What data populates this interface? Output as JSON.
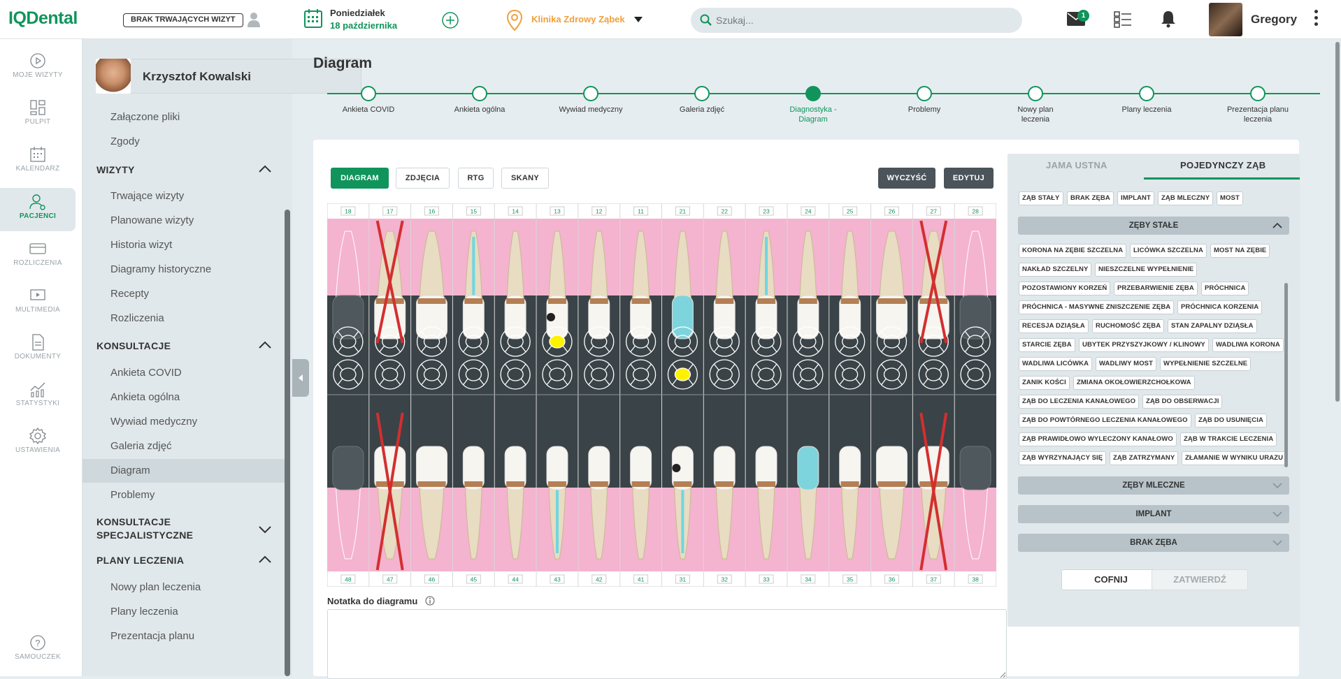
{
  "header": {
    "logo": "IQDental",
    "no_visits": "BRAK TRWAJĄCYCH WIZYT",
    "day": "Poniedziałek",
    "date": "18 października",
    "clinic": "Klinika Zdrowy Ząbek",
    "search_placeholder": "Szukaj...",
    "mail_count": "1",
    "user": "Gregory"
  },
  "nav": [
    "MOJE WIZYTY",
    "PULPIT",
    "KALENDARZ",
    "PACJENCI",
    "ROZLICZENIA",
    "MULTIMEDIA",
    "DOKUMENTY",
    "STATYSTYKI",
    "USTAWIENIA",
    "SAMOUCZEK"
  ],
  "patient": {
    "name": "Krzysztof Kowalski"
  },
  "submenu": {
    "top": [
      "Załączone pliki",
      "Zgody"
    ],
    "wizyty": "WIZYTY",
    "wizyty_items": [
      "Trwające wizyty",
      "Planowane wizyty",
      "Historia wizyt",
      "Diagramy historyczne",
      "Recepty",
      "Rozliczenia"
    ],
    "konsultacje": "KONSULTACJE",
    "konsultacje_items": [
      "Ankieta COVID",
      "Ankieta ogólna",
      "Wywiad medyczny",
      "Galeria zdjęć",
      "Diagram",
      "Problemy"
    ],
    "spec_1": "KONSULTACJE",
    "spec_2": "SPECJALISTYCZNE",
    "plany": "PLANY LECZENIA",
    "plany_items": [
      "Nowy plan leczenia",
      "Plany leczenia",
      "Prezentacja planu"
    ]
  },
  "main": {
    "title": "Diagram",
    "steps": [
      [
        "Ankieta COVID"
      ],
      [
        "Ankieta ogólna"
      ],
      [
        "Wywiad medyczny"
      ],
      [
        "Galeria zdjęć"
      ],
      [
        "Diagnostyka -",
        "Diagram"
      ],
      [
        "Problemy"
      ],
      [
        "Nowy plan",
        "leczenia"
      ],
      [
        "Plany leczenia"
      ],
      [
        "Prezentacja planu",
        "leczenia"
      ]
    ],
    "current_step": 4,
    "buttons": {
      "diagram": "DIAGRAM",
      "photos": "ZDJĘCIA",
      "rtg": "RTG",
      "scans": "SKANY",
      "clear": "WYCZYŚĆ",
      "edit": "EDYTUJ"
    },
    "note_label": "Notatka do diagramu"
  },
  "chart_data": {
    "type": "dental-chart",
    "upper": [
      "18",
      "17",
      "16",
      "15",
      "14",
      "13",
      "12",
      "11",
      "21",
      "22",
      "23",
      "24",
      "25",
      "26",
      "27",
      "28"
    ],
    "lower": [
      "48",
      "47",
      "46",
      "45",
      "44",
      "43",
      "42",
      "41",
      "31",
      "32",
      "33",
      "34",
      "35",
      "36",
      "37",
      "38"
    ],
    "missing": [
      "18",
      "28",
      "48",
      "38"
    ],
    "extracted": [
      "17",
      "27",
      "47",
      "37"
    ],
    "root_canal": [
      "15",
      "23",
      "43",
      "31"
    ],
    "crown": [
      "21",
      "34"
    ],
    "caries": [
      "13",
      "31"
    ],
    "filling_yellow": [
      "13",
      "31"
    ]
  },
  "panel": {
    "tabs": [
      "JAMA USTNA",
      "POJEDYNCZY ZĄB"
    ],
    "quick_tags": [
      "ZĄB STAŁY",
      "BRAK ZĘBA",
      "IMPLANT",
      "ZĄB MLECZNY",
      "MOST"
    ],
    "acc_perm": "ZĘBY STAŁE",
    "perm_tags": [
      [
        "KORONA NA ZĘBIE SZCZELNA",
        "LICÓWKA SZCZELNA",
        "MOST NA ZĘBIE"
      ],
      [
        "NAKŁAD SZCZELNY",
        "NIESZCZELNE WYPEŁNIENIE"
      ],
      [
        "POZOSTAWIONY KORZEŃ",
        "PRZEBARWIENIE ZĘBA",
        "PRÓCHNICA"
      ],
      [
        "PRÓCHNICA - MASYWNE ZNISZCZENIE ZĘBA",
        "PRÓCHNICA KORZENIA"
      ],
      [
        "RECESJA DZIĄSŁA",
        "RUCHOMOŚĆ ZĘBA",
        "STAN ZAPALNY DZIĄSŁA"
      ],
      [
        "STARCIE ZĘBA",
        "UBYTEK PRZYSZYJKOWY / KLINOWY",
        "WADLIWA KORONA"
      ],
      [
        "WADLIWA LICÓWKA",
        "WADLIWY MOST",
        "WYPEŁNIENIE SZCZELNE"
      ],
      [
        "ZANIK KOŚCI",
        "ZMIANA OKOŁOWIERZCHOŁKOWA"
      ],
      [
        "ZĄB DO LECZENIA KANAŁOWEGO",
        "ZĄB DO OBSERWACJI"
      ],
      [
        "ZĄB DO POWTÓRNEGO LECZENIA KANAŁOWEGO",
        "ZĄB DO USUNIĘCIA"
      ],
      [
        "ZĄB PRAWIDŁOWO WYLECZONY KANAŁOWO",
        "ZĄB W TRAKCIE LECZENIA"
      ],
      [
        "ZĄB WYRZYNAJĄCY SIĘ",
        "ZĄB ZATRZYMANY",
        "ZŁAMANIE W WYNIKU URAZU"
      ]
    ],
    "acc_milk": "ZĘBY MLECZNE",
    "acc_implant": "IMPLANT",
    "acc_missing": "BRAK ZĘBA",
    "back": "COFNIJ",
    "confirm": "ZATWIERDŹ"
  }
}
